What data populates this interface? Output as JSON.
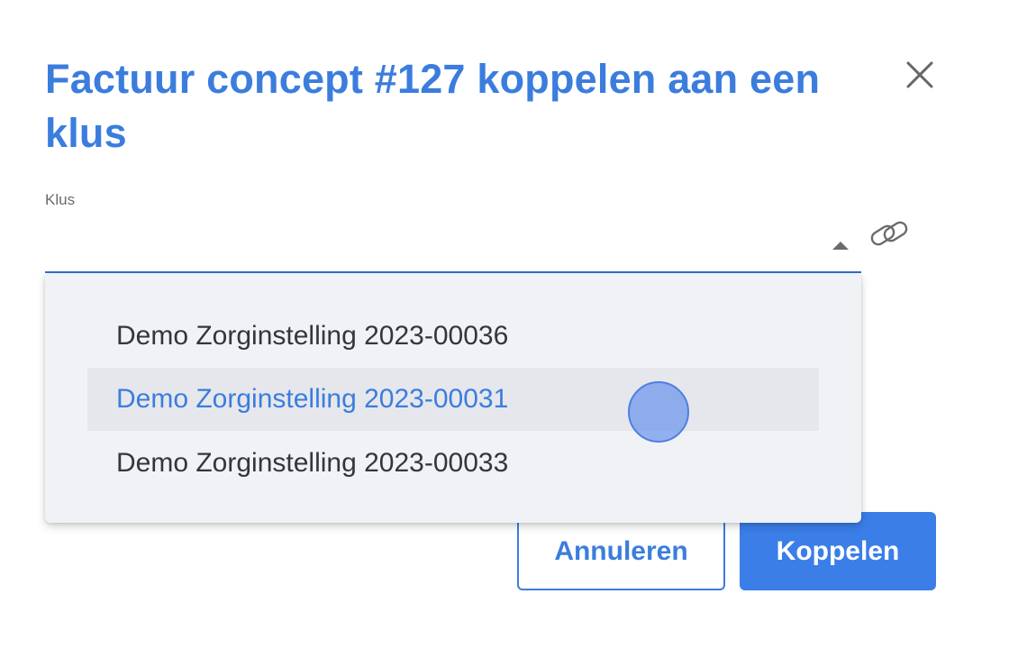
{
  "dialog": {
    "title": "Factuur concept #127 koppelen aan een klus",
    "close_icon": "close-icon"
  },
  "field": {
    "label": "Klus",
    "value": "",
    "arrow_icon": "caret-up-icon",
    "link_icon": "link-icon"
  },
  "dropdown": {
    "options": [
      {
        "label": "Demo Zorginstelling 2023-00036",
        "active": false
      },
      {
        "label": "Demo Zorginstelling 2023-00031",
        "active": true
      },
      {
        "label": "Demo Zorginstelling 2023-00033",
        "active": false
      }
    ]
  },
  "actions": {
    "cancel_label": "Annuleren",
    "submit_label": "Koppelen"
  },
  "colors": {
    "accent": "#3b7ddd",
    "primary_button": "#3b7ee8",
    "dropdown_bg": "#f1f2f6",
    "option_highlight": "#e6e7ec",
    "text": "#33363d"
  }
}
